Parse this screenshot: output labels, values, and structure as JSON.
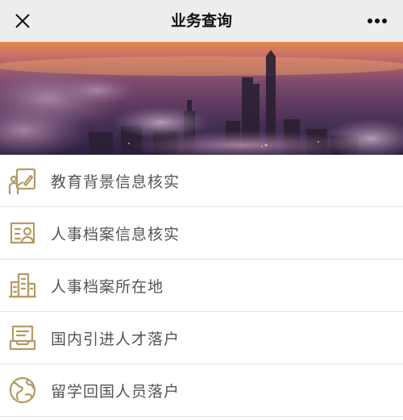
{
  "header": {
    "title": "业务查询",
    "close_icon": "close-icon",
    "more_icon": "more-icon"
  },
  "banner": {
    "description_icon": "city-skyline-image"
  },
  "menu": {
    "icon_color": "#b49a63",
    "items": [
      {
        "label": "教育背景信息核实",
        "icon": "teaching-board-icon"
      },
      {
        "label": "人事档案信息核实",
        "icon": "profile-card-icon"
      },
      {
        "label": "人事档案所在地",
        "icon": "buildings-icon"
      },
      {
        "label": "国内引进人才落户",
        "icon": "document-tray-icon"
      },
      {
        "label": "留学回国人员落户",
        "icon": "globe-icon"
      }
    ]
  }
}
